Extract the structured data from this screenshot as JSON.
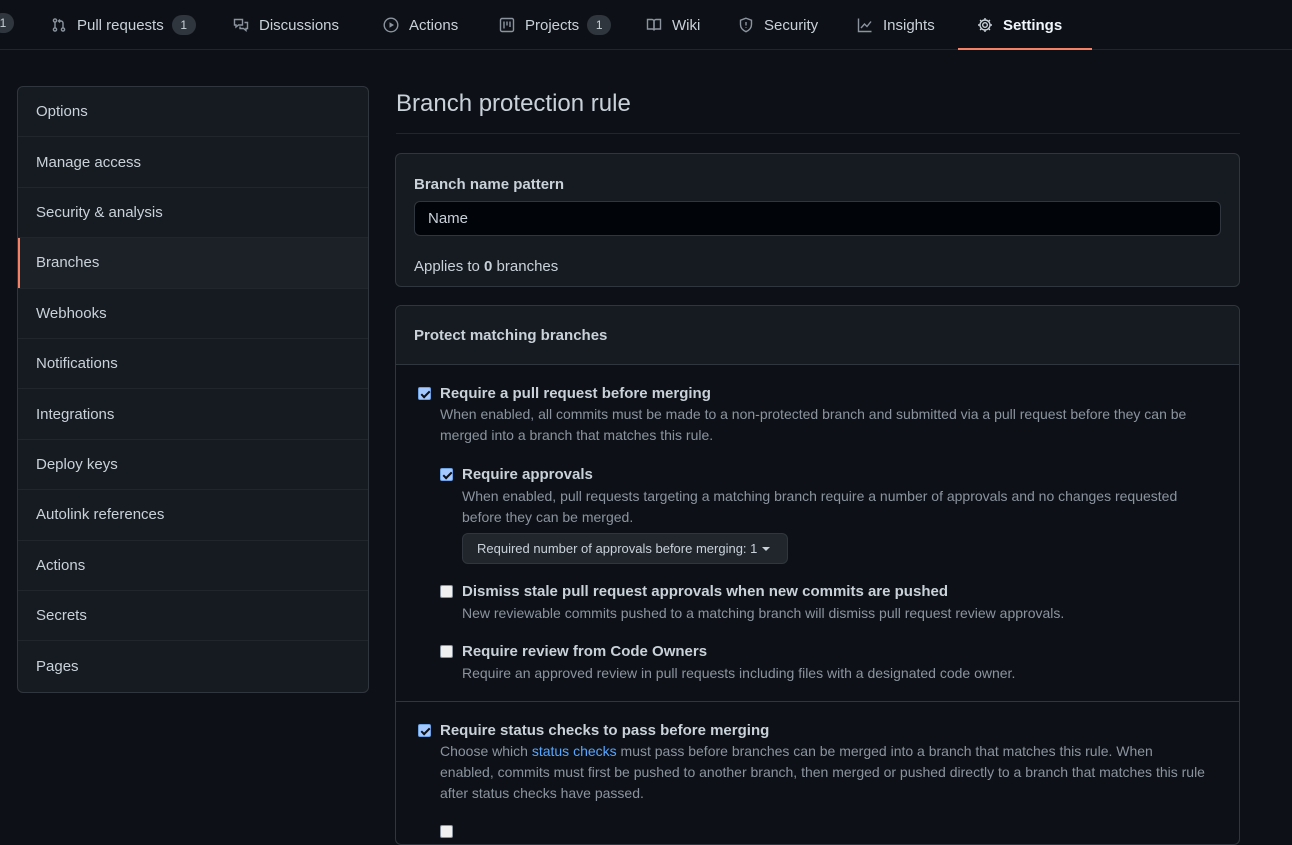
{
  "nav": {
    "left_counter": "1",
    "tabs": [
      {
        "label": "Pull requests",
        "icon": "git-pull-request-icon",
        "counter": "1"
      },
      {
        "label": "Discussions",
        "icon": "comment-discussion-icon"
      },
      {
        "label": "Actions",
        "icon": "play-icon"
      },
      {
        "label": "Projects",
        "icon": "project-icon",
        "counter": "1"
      },
      {
        "label": "Wiki",
        "icon": "book-icon"
      },
      {
        "label": "Security",
        "icon": "shield-icon"
      },
      {
        "label": "Insights",
        "icon": "graph-icon"
      },
      {
        "label": "Settings",
        "icon": "gear-icon",
        "selected": true
      }
    ]
  },
  "sidebar": {
    "items": [
      {
        "label": "Options"
      },
      {
        "label": "Manage access"
      },
      {
        "label": "Security & analysis"
      },
      {
        "label": "Branches",
        "selected": true
      },
      {
        "label": "Webhooks"
      },
      {
        "label": "Notifications"
      },
      {
        "label": "Integrations"
      },
      {
        "label": "Deploy keys"
      },
      {
        "label": "Autolink references"
      },
      {
        "label": "Actions"
      },
      {
        "label": "Secrets"
      },
      {
        "label": "Pages"
      }
    ]
  },
  "main": {
    "title": "Branch protection rule",
    "pattern": {
      "label": "Branch name pattern",
      "value": "Name",
      "applies_prefix": "Applies to ",
      "applies_count": "0",
      "applies_suffix": " branches"
    },
    "protect": {
      "heading": "Protect matching branches",
      "options": [
        {
          "title": "Require a pull request before merging",
          "checked": true,
          "desc": "When enabled, all commits must be made to a non-protected branch and submitted via a pull request before they can be merged into a branch that matches this rule."
        },
        {
          "title": "Require approvals",
          "checked": true,
          "desc": "When enabled, pull requests targeting a matching branch require a number of approvals and no changes requested before they can be merged.",
          "dropdown": "Required number of approvals before merging: 1"
        },
        {
          "title": "Dismiss stale pull request approvals when new commits are pushed",
          "checked": false,
          "desc": "New reviewable commits pushed to a matching branch will dismiss pull request review approvals."
        },
        {
          "title": "Require review from Code Owners",
          "checked": false,
          "desc": "Require an approved review in pull requests including files with a designated code owner."
        },
        {
          "title": "Require status checks to pass before merging",
          "checked": true,
          "desc_before": "Choose which ",
          "desc_link": "status checks",
          "desc_after": " must pass before branches can be merged into a branch that matches this rule. When enabled, commits must first be pushed to another branch, then merged or pushed directly to a branch that matches this rule after status checks have passed."
        }
      ]
    }
  },
  "colors": {
    "accent": "#f78166",
    "link": "#58a6ff",
    "background": "#0d1117",
    "panel": "#161b22"
  }
}
